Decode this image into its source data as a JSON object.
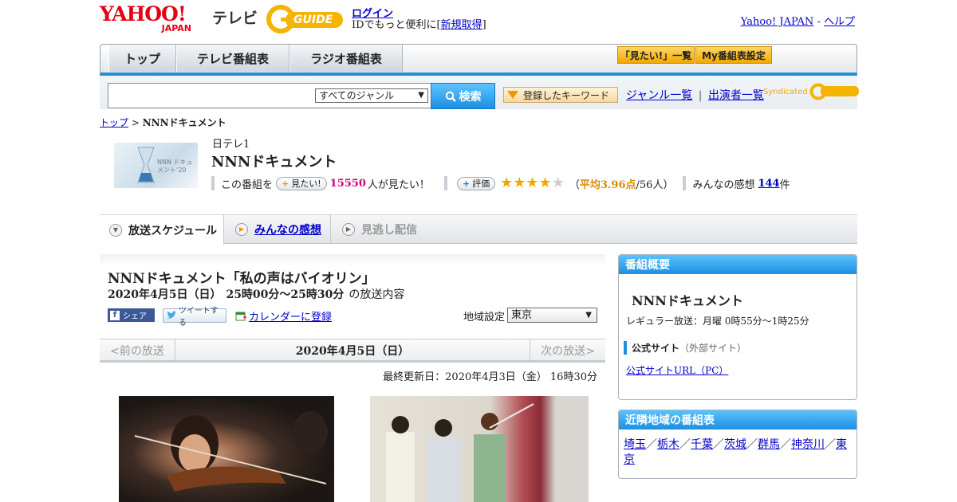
{
  "header": {
    "yahoo_top": "YAHOO!",
    "yahoo_bottom": "JAPAN",
    "tv_label": "テレビ",
    "gguide": "GUIDE",
    "login_label": "ログイン",
    "login_note_prefix": "IDでもっと便利に[",
    "signup_label": "新規取得",
    "login_note_suffix": "]",
    "yahoo_japan_link": "Yahoo! JAPAN",
    "link_sep": " - ",
    "help_link": "ヘルプ"
  },
  "nav": {
    "tabs": [
      "トップ",
      "テレビ番組表",
      "ラジオ番組表"
    ],
    "mitai_list": "「見たい!」一覧",
    "my_bangumi": "My番組表設定"
  },
  "search": {
    "placeholder": "",
    "genre_selected": "すべてのジャンル",
    "button_label": "検索",
    "keyword_button": "登録したキーワード",
    "genre_list_link": "ジャンル一覧",
    "divider": "|",
    "performer_link": "出演者一覧",
    "syndicated": "Syndicated"
  },
  "breadcrumb": {
    "top": "トップ",
    "sep": " > ",
    "current": "NNNドキュメント"
  },
  "program": {
    "channel": "日テレ1",
    "title": "NNNドキュメント",
    "mitai_prefix": "この番組を",
    "mitai_pill": "見たい!",
    "mitai_count": "15550",
    "mitai_suffix": "人が見たい！",
    "rating_pill": "評価",
    "rating_value": 3.96,
    "rating_open": "（",
    "rating_avg": "平均3.96点",
    "rating_people": "/56人）",
    "kanso_prefix": "みんなの感想",
    "kanso_count": "144",
    "kanso_suffix": "件",
    "thumb_text": "NNN ドキュメント'20"
  },
  "tabs": {
    "schedule": "放送スケジュール",
    "kanso": "みんなの感想",
    "minogashi": "見逃し配信"
  },
  "episode": {
    "title": "NNNドキュメント「私の声はバイオリン」",
    "date": "2020年4月5日（日）",
    "time": "25時00分～25時30分",
    "suffix": "の放送内容",
    "fb_share": "シェア",
    "tweet": "ツイートする",
    "calendar": "カレンダーに登録",
    "region_label": "地域設定",
    "region_selected": "東京"
  },
  "daynav": {
    "prev": "<前の放送",
    "day": "2020年4月5日（日）",
    "next": "次の放送>"
  },
  "updated": "最終更新日：2020年4月3日（金） 16時30分",
  "sidebar": {
    "overview_head": "番組概要",
    "overview_title": "NNNドキュメント",
    "regular": "レギュラー放送：月曜 0時55分～1時25分",
    "official_label": "公式サイト",
    "official_ext": "（外部サイト）",
    "official_url": "公式サイトURL（PC）",
    "nearby_head": "近隣地域の番組表",
    "nearby_regions": [
      "埼玉",
      "栃木",
      "千葉",
      "茨城",
      "群馬",
      "神奈川",
      "東京"
    ],
    "nearby_sep": "／"
  },
  "colors": {
    "accent_blue": "#1b8fe0",
    "link": "#0000cc",
    "mitai_pink": "#d4007a",
    "star_gold": "#f0a800"
  }
}
